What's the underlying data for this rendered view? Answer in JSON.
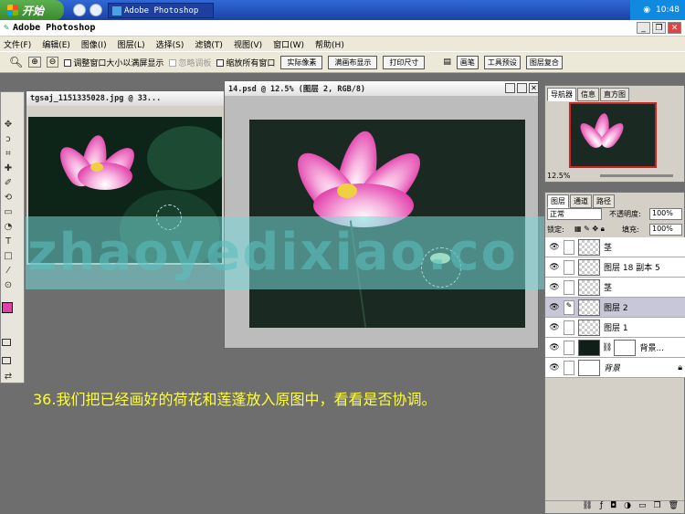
{
  "taskbar": {
    "start_label": "开始",
    "task_label": "Adobe Photoshop",
    "clock": "10:48"
  },
  "app": {
    "title": "Adobe Photoshop"
  },
  "menu": [
    "文件(F)",
    "编辑(E)",
    "图像(I)",
    "图层(L)",
    "选择(S)",
    "滤镜(T)",
    "视图(V)",
    "窗口(W)",
    "帮助(H)"
  ],
  "options": {
    "resize_window": "调整窗口大小以满屏显示",
    "ignore_palettes": "忽略调板",
    "zoom_all": "缩放所有窗口",
    "actual_pixels": "实际像素",
    "fit_screen": "满画布显示",
    "print_size": "打印尺寸",
    "tabs": [
      "画笔",
      "工具预设",
      "图层复合"
    ]
  },
  "doc1": {
    "title": "tgsaj_1151335028.jpg @ 33..."
  },
  "doc2": {
    "title": "14.psd @ 12.5% (图层 2, RGB/8)"
  },
  "watermark": "zhaoyedixiao.co",
  "caption": "36.我们把已经画好的荷花和莲蓬放入原图中，看看是否协调。",
  "navigator": {
    "tabs": [
      "导航器",
      "信息",
      "直方图"
    ],
    "zoom": "12.5%"
  },
  "layers": {
    "tabs": [
      "图层",
      "通道",
      "路径"
    ],
    "blend_mode": "正常",
    "opacity_label": "不透明度:",
    "opacity_value": "100%",
    "lock_label": "锁定:",
    "fill_label": "填充:",
    "fill_value": "100%",
    "rows": [
      {
        "name": "茎"
      },
      {
        "name": "图层 18 副本 5"
      },
      {
        "name": "茎"
      },
      {
        "name": "图层 2"
      },
      {
        "name": "图层 1"
      },
      {
        "name": "背景..."
      },
      {
        "name": "背景"
      }
    ]
  }
}
